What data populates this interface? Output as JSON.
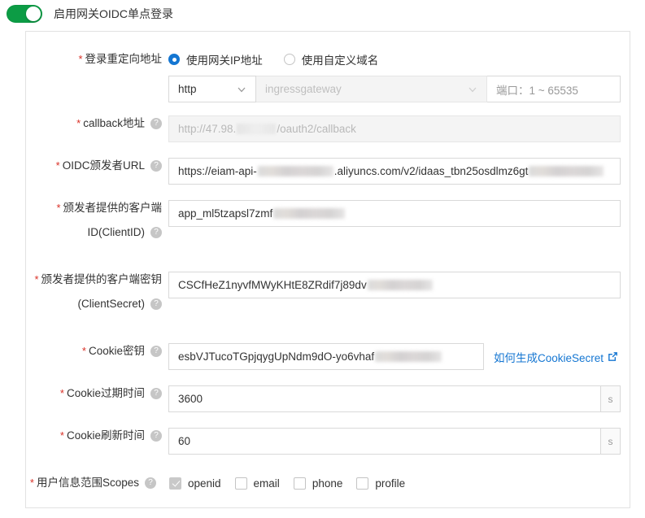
{
  "header": {
    "toggle_label": "启用网关OIDC单点登录",
    "toggle_on": true,
    "toggle_color": "#0c9c45"
  },
  "colors": {
    "accent": "#1476d2",
    "required": "#d93026",
    "switch_on": "#0c9c45",
    "border": "#d9d9d9",
    "disabled_bg": "#f4f4f4"
  },
  "form": {
    "redirect": {
      "label": "登录重定向地址",
      "required": true,
      "radios": [
        {
          "label": "使用网关IP地址",
          "checked": true
        },
        {
          "label": "使用自定义域名",
          "checked": false
        }
      ],
      "scheme_value": "http",
      "host_value": "ingressgateway",
      "host_disabled": true,
      "port_placeholder": "端口：1 ~ 65535"
    },
    "callback": {
      "label": "callback地址",
      "required": true,
      "help": true,
      "disabled": true,
      "value_prefix": "http://47.98.",
      "value_suffix": "/oauth2/callback"
    },
    "issuer_url": {
      "label": "OIDC颁发者URL",
      "required": true,
      "help": true,
      "value_part1": "https://eiam-api-",
      "value_part2": ".aliyuncs.com/v2/idaas_tbn25osdlmz6gt"
    },
    "client_id": {
      "label_line1": "颁发者提供的客户端",
      "label_line2": "ID(ClientID)",
      "required": true,
      "help": true,
      "value": "app_ml5tzapsl7zmf"
    },
    "client_secret": {
      "label_line1": "颁发者提供的客户端密钥",
      "label_line2": "(ClientSecret)",
      "required": true,
      "help": true,
      "value": "CSCfHeZ1nyvfMWyKHtE8ZRdif7j89dv"
    },
    "cookie_secret": {
      "label": "Cookie密钥",
      "required": true,
      "help": true,
      "value": "esbVJTucoTGpjqygUpNdm9dO-yo6vhaf",
      "link_text": "如何生成CookieSecret"
    },
    "cookie_expire": {
      "label": "Cookie过期时间",
      "required": true,
      "help": true,
      "value": "3600",
      "unit": "s"
    },
    "cookie_refresh": {
      "label": "Cookie刷新时间",
      "required": true,
      "help": true,
      "value": "60",
      "unit": "s"
    },
    "scopes": {
      "label": "用户信息范围Scopes",
      "required": true,
      "help": true,
      "items": [
        {
          "label": "openid",
          "checked": true,
          "disabled": true
        },
        {
          "label": "email",
          "checked": false,
          "disabled": false
        },
        {
          "label": "phone",
          "checked": false,
          "disabled": false
        },
        {
          "label": "profile",
          "checked": false,
          "disabled": false
        }
      ]
    }
  },
  "icons": {
    "help": "?",
    "chevron_down": "chevron-down-icon",
    "external_link": "external-link-icon"
  }
}
